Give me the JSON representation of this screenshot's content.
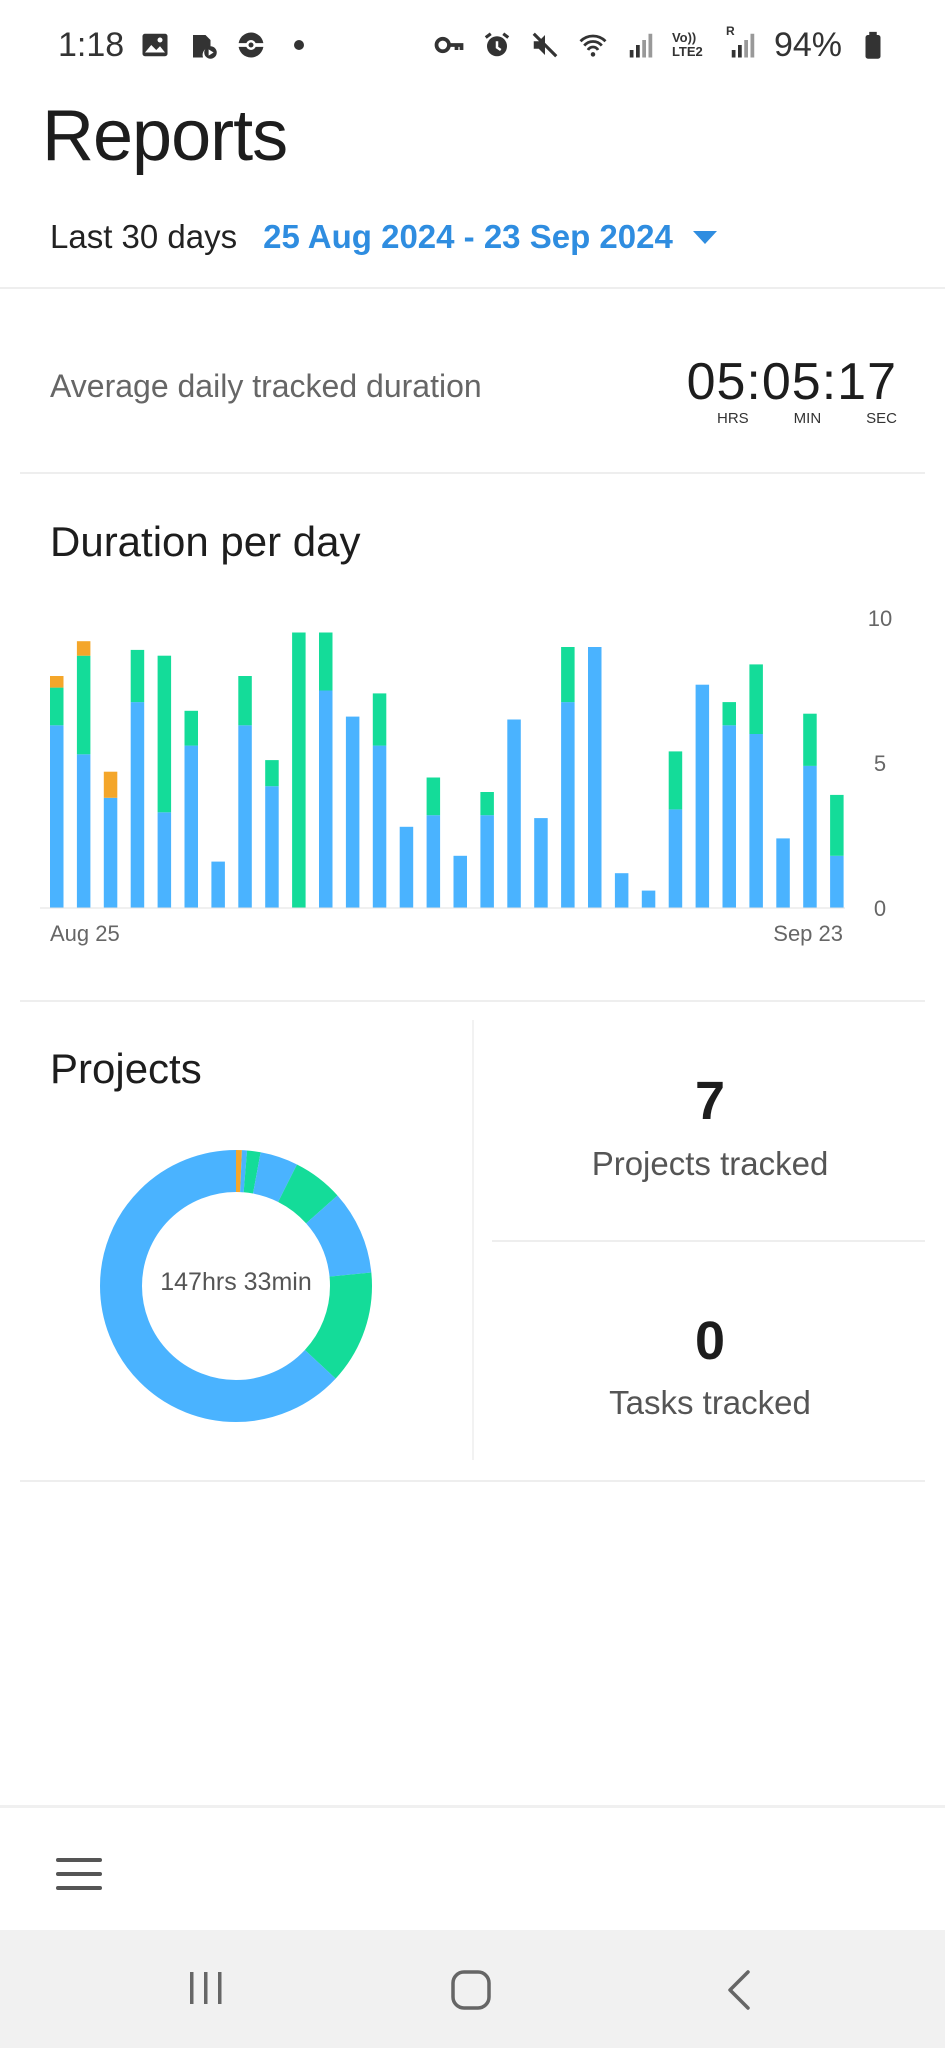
{
  "status_bar": {
    "time": "1:18",
    "battery": "94%",
    "left_icons": [
      "image-icon",
      "app-notification-icon",
      "pokeball-icon",
      "dot-icon"
    ],
    "right_icons": [
      "vpn-key-icon",
      "alarm-icon",
      "mute-icon",
      "wifi-icon",
      "signal-icon",
      "volte-icon",
      "signal-icon",
      "battery-icon"
    ],
    "volte_text": "Vo)) LTE2",
    "roaming_text": "R"
  },
  "header": {
    "title": "Reports"
  },
  "date_range": {
    "label": "Last 30 days",
    "value": "25 Aug 2024 - 23 Sep 2024"
  },
  "average": {
    "label": "Average daily tracked duration",
    "time": "05:05:17",
    "units": [
      "HRS",
      "MIN",
      "SEC"
    ]
  },
  "chart_data": {
    "type": "bar",
    "title": "Duration per day",
    "stacked": true,
    "x_start_label": "Aug 25",
    "x_end_label": "Sep 23",
    "ylim": [
      0,
      10
    ],
    "yticks": [
      0,
      5,
      10
    ],
    "y_axis_position": "right",
    "series": [
      {
        "color": "#4ab3ff",
        "values": [
          6.3,
          5.3,
          3.8,
          7.1,
          3.3,
          5.6,
          1.6,
          6.3,
          4.2,
          0,
          7.5,
          6.6,
          5.6,
          2.8,
          3.2,
          1.8,
          3.2,
          6.5,
          3.1,
          7.1,
          9.0,
          1.2,
          0.6,
          3.4,
          7.7,
          6.3,
          6.0,
          2.4,
          4.9,
          1.8
        ],
        "segments": [
          [
            6.3
          ],
          [
            5.3
          ],
          [
            3.8
          ],
          [
            7.1
          ],
          [
            3.3
          ],
          [
            5.6
          ],
          [
            1.6
          ],
          [
            6.3
          ],
          [
            2.0,
            2.2
          ],
          [
            0
          ],
          [
            7.5
          ],
          [
            6.6
          ],
          [
            5.6
          ],
          [
            2.8
          ],
          [
            3.2
          ],
          [
            1.8
          ],
          [
            3.2
          ],
          [
            6.5
          ],
          [
            3.1
          ],
          [
            7.1
          ],
          [
            9.0
          ],
          [
            1.2
          ],
          [
            0.6
          ],
          [
            3.4
          ],
          [
            7.7
          ],
          [
            6.3
          ],
          [
            6.0
          ],
          [
            2.4
          ],
          [
            4.9
          ],
          [
            0.7
          ]
        ]
      },
      {
        "color": "#14dc99",
        "values": [
          1.3,
          3.4,
          0,
          1.8,
          5.4,
          1.2,
          0,
          1.7,
          0.9,
          9.5,
          2.0,
          0,
          1.8,
          0,
          1.3,
          0,
          0.8,
          0,
          0,
          1.9,
          0,
          0,
          0,
          2.0,
          0,
          0.8,
          2.4,
          0,
          1.8,
          2.1
        ],
        "segments": []
      },
      {
        "color": "#f4a62a",
        "values": [
          0.4,
          0.5,
          0.9,
          0,
          0,
          0,
          0,
          0,
          0,
          0,
          0,
          0,
          0,
          0,
          0,
          0,
          0,
          0,
          0,
          0,
          0,
          0,
          0,
          0,
          0,
          0,
          0,
          0,
          0,
          0
        ],
        "segments": []
      }
    ]
  },
  "projects": {
    "title": "Projects",
    "total_label": "147hrs 33min",
    "donut_segments": [
      {
        "color": "#f4a62a",
        "fraction": 0.007
      },
      {
        "color": "#4ab3ff",
        "fraction": 0.006
      },
      {
        "color": "#14dc99",
        "fraction": 0.016
      },
      {
        "color": "#4ab3ff",
        "fraction": 0.045
      },
      {
        "color": "#14dc99",
        "fraction": 0.06
      },
      {
        "color": "#4ab3ff",
        "fraction": 0.1
      },
      {
        "color": "#14dc99",
        "fraction": 0.135
      },
      {
        "color": "#4ab3ff",
        "fraction": 0.631
      }
    ],
    "projects_tracked": "7",
    "projects_tracked_label": "Projects tracked",
    "tasks_tracked": "0",
    "tasks_tracked_label": "Tasks tracked"
  },
  "bottom_nav": {
    "menu_icon": "hamburger-menu-icon"
  },
  "system_nav": [
    "recent-apps-icon",
    "home-icon",
    "back-icon"
  ],
  "colors": {
    "accent": "#2f8de0",
    "bar_blue": "#4ab3ff",
    "bar_green": "#14dc99",
    "bar_orange": "#f4a62a"
  }
}
